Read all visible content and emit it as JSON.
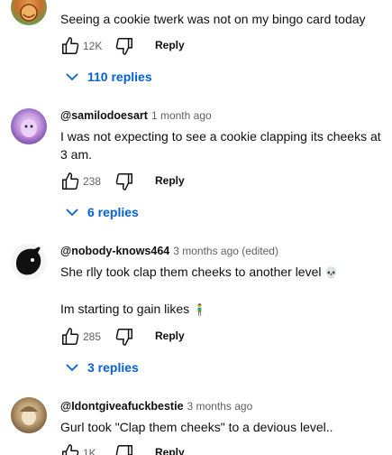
{
  "comments": [
    {
      "text": "Seeing a cookie twerk was not on my bingo card today",
      "likes": "12K",
      "reply_label": "Reply",
      "replies_label": "110 replies"
    },
    {
      "handle": "@samilodoesart",
      "time": "1 month ago",
      "text": "I was not expecting to see a cookie clapping its cheeks at 3 am.",
      "likes": "238",
      "reply_label": "Reply",
      "replies_label": "6 replies"
    },
    {
      "handle": "@nobody-knows464",
      "time": "3 months ago (edited)",
      "text_line1": "She rlly took clap them cheeks to another level",
      "emoji1": "💀",
      "text_line2": "Im starting to gain likes",
      "emoji2": "🧍‍♂️",
      "likes": "285",
      "reply_label": "Reply",
      "replies_label": "3 replies"
    },
    {
      "handle": "@Idontgiveafuckbestie",
      "time": "3 months ago",
      "text": "Gurl took \"Clap them cheeks\" to a devious level..",
      "likes": "1K",
      "reply_label": "Reply"
    }
  ],
  "colors": {
    "link_blue": "#065fd4",
    "muted": "#606060"
  },
  "icons": [
    "like-icon",
    "dislike-icon",
    "chevron-down-icon"
  ]
}
